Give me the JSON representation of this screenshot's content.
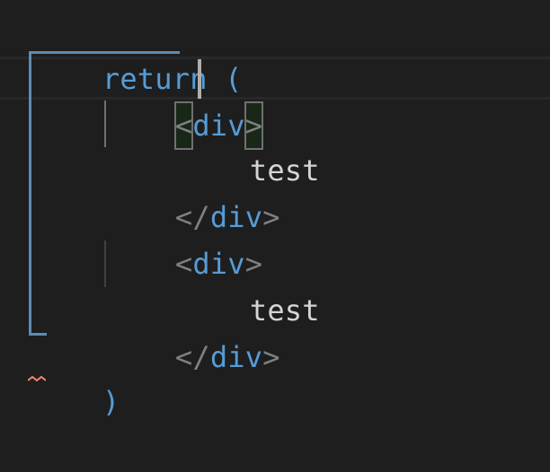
{
  "editor": {
    "lines": [
      {
        "keyword": "return",
        "paren": "("
      },
      {
        "open": "<",
        "tag": "div",
        "close": ">"
      },
      {
        "text": "test"
      },
      {
        "open": "</",
        "tag": "div",
        "close": ">"
      },
      {
        "open": "<",
        "tag": "div",
        "close": ">"
      },
      {
        "text": "test"
      },
      {
        "open": "</",
        "tag": "div",
        "close": ">"
      },
      {
        "paren": ")"
      }
    ]
  },
  "colors": {
    "background": "#1e1e1e",
    "keyword": "#569cd6",
    "punctuation": "#808080",
    "text": "#d4d4d4",
    "bracket_guide": "#5a8db5",
    "squiggle": "#f48771"
  }
}
